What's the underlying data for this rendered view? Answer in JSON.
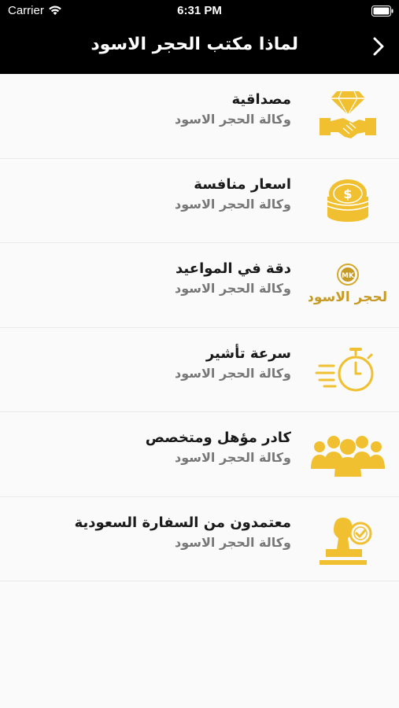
{
  "status_bar": {
    "carrier": "Carrier",
    "time": "6:31 PM"
  },
  "nav": {
    "title": "لماذا مكتب الحجر الاسود",
    "chevron_icon": "chevron-right-icon"
  },
  "colors": {
    "accent_gold": "#f0c030",
    "header_bg": "#000000",
    "title_text": "#1a1a1a",
    "subtitle_text": "#777777"
  },
  "items": [
    {
      "title": "مصداقية",
      "subtitle": "وكالة الحجر الاسود",
      "icon": "diamond-handshake-icon"
    },
    {
      "title": "اسعار منافسة",
      "subtitle": "وكالة الحجر الاسود",
      "icon": "coins-icon"
    },
    {
      "title": "دقة في المواعيد",
      "subtitle": "وكالة الحجر الاسود",
      "icon": "brand-logo-icon",
      "logo_text": "الحجر الاسود",
      "logo_badge": "MK"
    },
    {
      "title": "سرعة تأشير",
      "subtitle": "وكالة الحجر الاسود",
      "icon": "stopwatch-icon"
    },
    {
      "title": "كادر مؤهل ومتخصص",
      "subtitle": "وكالة الحجر الاسود",
      "icon": "team-icon"
    },
    {
      "title": "معتمدون من السفارة السعودية",
      "subtitle": "وكالة الحجر الاسود",
      "icon": "approval-stamp-icon"
    }
  ]
}
